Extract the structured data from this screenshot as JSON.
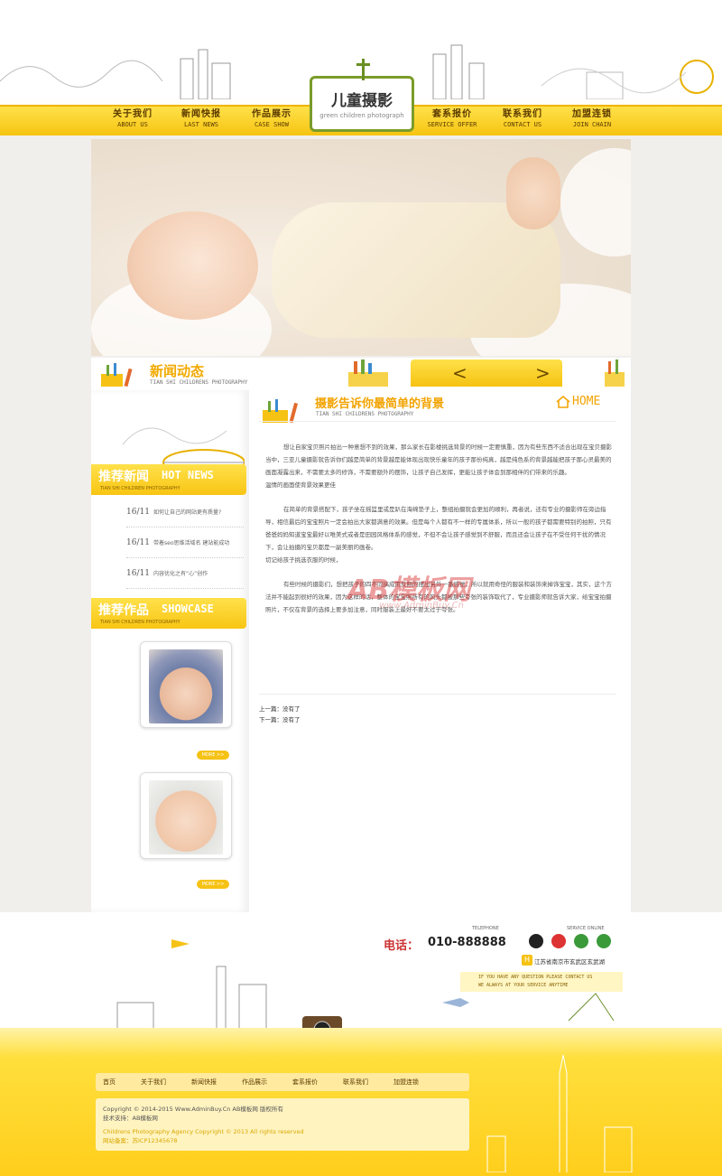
{
  "header": {
    "logo_title": "儿童摄影",
    "logo_subtitle": "green children photograph",
    "nav": [
      {
        "cn": "关于我们",
        "en": "ABOUT US"
      },
      {
        "cn": "新闻快报",
        "en": "LAST NEWS"
      },
      {
        "cn": "作品展示",
        "en": "CASE SHOW"
      },
      {
        "cn": "套系报价",
        "en": "SERVICE OFFER"
      },
      {
        "cn": "联系我们",
        "en": "CONTACT US"
      },
      {
        "cn": "加盟连锁",
        "en": "JOIN CHAIN"
      }
    ]
  },
  "news_bar": {
    "title": "新闻动态",
    "subtitle": "TIAN SHI CHILDRENS PHOTOGRAPHY",
    "prev_label": "<",
    "next_label": ">"
  },
  "sidebar": {
    "hot_news": {
      "cn": "推荐新闻",
      "en": "HOT NEWS",
      "sub": "TIAN SHI CHILDREN PHOTOGRAPHY",
      "items": [
        {
          "date": "16/11",
          "title": "如何让自己的网站更有质量?"
        },
        {
          "date": "16/11",
          "title": "带着seo思维活域名 建站能成功"
        },
        {
          "date": "16/11",
          "title": "内容优化之有“心”创作"
        }
      ]
    },
    "showcase": {
      "cn": "推荐作品",
      "en": "SHOWCASE",
      "sub": "TIAN SHI CHILDREN PHOTOGRAPHY",
      "more_label": "MORE >>"
    }
  },
  "article": {
    "title": "摄影告诉你最简单的背景",
    "subtitle": "TIAN SHI CHILDRENS PHOTOGRAPHY",
    "home_label": "HOME",
    "paragraphs": [
      "想让自家宝贝照片拍出一种意想不到的效果，那么家长在影楼挑选背景的时候一定要慎重，因为有些东西不适合出现在宝贝摄影当中，三亚儿童摄影就告诉你们越是简单的背景越是能体现出现快乐童年的孩子那份纯真，越是纯色系的背景越能把孩子那心灵最美的画面凝露出来，不需要太多的修饰，不需要额外的摆饰，让孩子自己发挥，更能让孩子体会到那相伴的们带来的乐趣。",
      "温情的画面使背景效果更佳",
      "在简单的背景搭配下，孩子坐在摇篮里或是趴在海绵垫子上，整组拍摄就会更加的顺利，再者说，还有专业的摄影师在旁边指导，相信最后的宝宝照片一定会拍出大家都满意的效果。但是每个人都有不一样的专属体系，所以一般的孩子都需要特别的拍照，只有爸爸妈妈知道宝宝最好以唯美式或者是田园风格体系的感觉，不但不会让孩子感觉到不舒服，而且还会让孩子在不受任何干扰的情况下，会让拍摄的宝贝都是一副美丽的画卷。",
      "切记给孩子挑选衣服的时候，",
      "有些时候的摄影们，想把孩子的四不同搞成用反照的摆出另外一番感觉，所以就用奇怪的服装和装饰来掉饰宝宝，其实，这个方法并不能起到很好的效果，因为这样的话，整体的宝宝照所有的风头都被那些夸张的装饰取代了，专业摄影师就告诉大家，给宝宝拍摄照片，不仅在背景的选择上要多加注意，同时服装上最好不要太过于夸张。"
    ],
    "prev_label": "上一篇：没有了",
    "next_label": "下一篇：没有了",
    "watermark": "AB模板网",
    "watermark_sub": "www.AdminBuy.Cn"
  },
  "footer": {
    "telephone_en": "TELEPHONE",
    "phone_label": "电话：",
    "phone": "010-888888",
    "service_en": "SERVICE ONLINE",
    "address": "江苏省南京市玄武区玄武湖",
    "contact_line1": "IF YOU HAVE ANY QUESTION PLEASE CONTACT US",
    "contact_line2": "WE ALWAYS AT YOUR SERVICE ANYTIME",
    "nav": [
      "首页",
      "关于我们",
      "新闻快报",
      "作品展示",
      "套系报价",
      "联系我们",
      "加盟连锁"
    ],
    "copyright": "Copyright © 2014-2015 Www.AdminBuy.Cn AB模板网 版权所有",
    "tech_support": "技术支持：AB模板网",
    "copyright_en": "Childrens Photography Agency Copyright © 2013 All rights reserved",
    "icp": "网站备案：苏ICP12345678"
  },
  "colors": {
    "accent": "#f6c214",
    "accent_dark": "#f2a300",
    "phone_red": "#cc3333"
  }
}
